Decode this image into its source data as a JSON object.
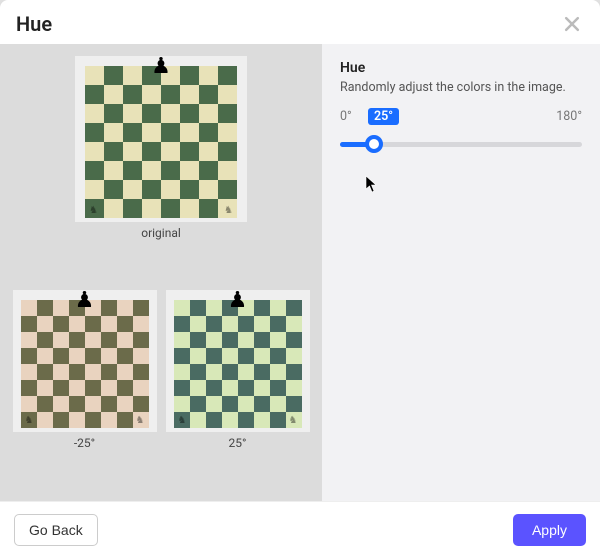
{
  "modal": {
    "title": "Hue"
  },
  "previews": {
    "original_caption": "original",
    "variant_minus_caption": "-25°",
    "variant_plus_caption": "25°"
  },
  "settings": {
    "title": "Hue",
    "description": "Randomly adjust the colors in the image.",
    "range_min_label": "0°",
    "range_max_label": "180°",
    "current_value_label": "25°",
    "current_value": 25,
    "range_min": 0,
    "range_max": 180
  },
  "footer": {
    "go_back_label": "Go Back",
    "apply_label": "Apply"
  },
  "board_colors": {
    "original_light": "#e8e2b8",
    "original_dark": "#4a6b4a",
    "minus_light": "#e9d3bf",
    "minus_dark": "#6b6b4a",
    "plus_light": "#d8e8b8",
    "plus_dark": "#4a6b62"
  }
}
